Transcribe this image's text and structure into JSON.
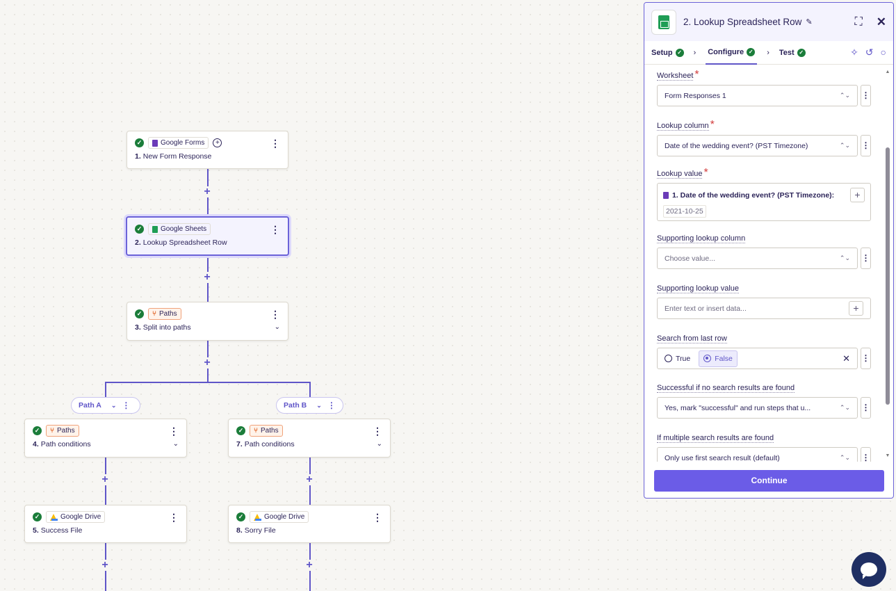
{
  "canvas": {
    "nodes": [
      {
        "app": "Google Forms",
        "step": "1.",
        "title": "New Form Response"
      },
      {
        "app": "Google Sheets",
        "step": "2.",
        "title": "Lookup Spreadsheet Row"
      },
      {
        "app": "Paths",
        "step": "3.",
        "title": "Split into paths"
      },
      {
        "app": "Paths",
        "step": "4.",
        "title": "Path conditions"
      },
      {
        "app": "Google Drive",
        "step": "5.",
        "title": "Success File"
      },
      {
        "app": "Paths",
        "step": "7.",
        "title": "Path conditions"
      },
      {
        "app": "Google Drive",
        "step": "8.",
        "title": "Sorry File"
      }
    ],
    "paths": [
      {
        "label": "Path A"
      },
      {
        "label": "Path B"
      }
    ]
  },
  "panel": {
    "title": "2. Lookup Spreadsheet Row",
    "tabs": [
      {
        "label": "Setup"
      },
      {
        "label": "Configure"
      },
      {
        "label": "Test"
      }
    ],
    "fields": {
      "worksheet": {
        "label": "Worksheet",
        "value": "Form Responses 1"
      },
      "lookup_column": {
        "label": "Lookup column",
        "value": "Date of the wedding event? (PST Timezone)"
      },
      "lookup_value": {
        "label": "Lookup value",
        "chip": "1. Date of the wedding event? (PST Timezone):",
        "sample": "2021-10-25"
      },
      "supporting_column": {
        "label": "Supporting lookup column",
        "placeholder": "Choose value..."
      },
      "supporting_value": {
        "label": "Supporting lookup value",
        "placeholder": "Enter text or insert data..."
      },
      "search_last_row": {
        "label": "Search from last row",
        "options": [
          "True",
          "False"
        ],
        "selected": "False"
      },
      "successful_if_none": {
        "label": "Successful if no search results are found",
        "value": "Yes, mark \"successful\" and run steps that u..."
      },
      "multiple_results": {
        "label": "If multiple search results are found",
        "value": "Only use first search result (default)"
      }
    },
    "continue_label": "Continue"
  },
  "colors": {
    "accent": "#6b5ce7",
    "success": "#1b7d3a",
    "paths": "#e0672b",
    "line": "#5f55c8"
  }
}
